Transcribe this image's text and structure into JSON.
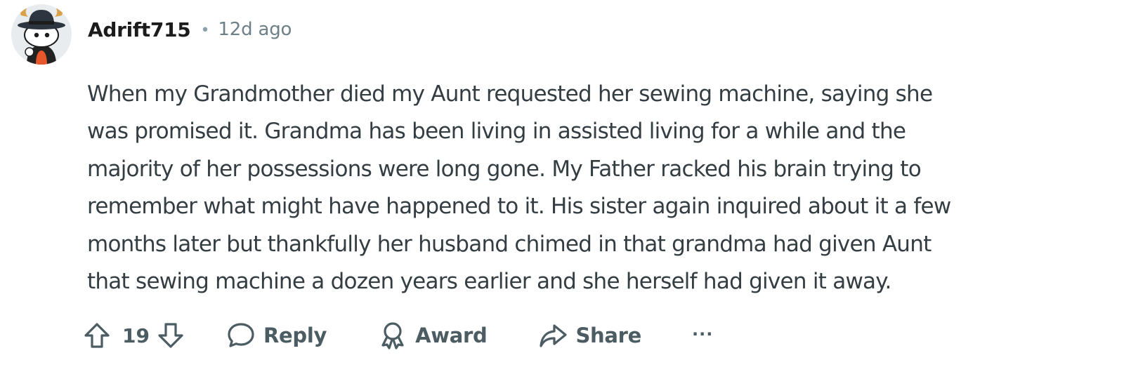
{
  "comment": {
    "username": "Adrift715",
    "separator": "•",
    "time_ago": "12d ago",
    "avatar_icon": "snoo-avatar-cowboy-hat-icon",
    "body_lines": [
      "When my Grandmother died my Aunt requested her sewing machine, saying she",
      "was promised it. Grandma has been living in assisted living for a while and the",
      "majority of her possessions were long gone. My Father racked his brain trying to",
      "remember what might have happened to it. His sister again inquired about it a few",
      "months later but thankfully her husband chimed in that grandma had given Aunt",
      "that sewing machine a dozen years earlier and she herself had given it away."
    ]
  },
  "actions": {
    "upvote_icon": "upvote-arrow-icon",
    "vote_count": "19",
    "downvote_icon": "downvote-arrow-icon",
    "reply_icon": "speech-bubble-icon",
    "reply_label": "Reply",
    "award_icon": "award-medal-icon",
    "award_label": "Award",
    "share_icon": "share-arrow-icon",
    "share_label": "Share",
    "more_label": "···"
  },
  "colors": {
    "text": "#333d42",
    "muted": "#6d8088",
    "action": "#4c5c63",
    "username": "#1c1c1c"
  }
}
